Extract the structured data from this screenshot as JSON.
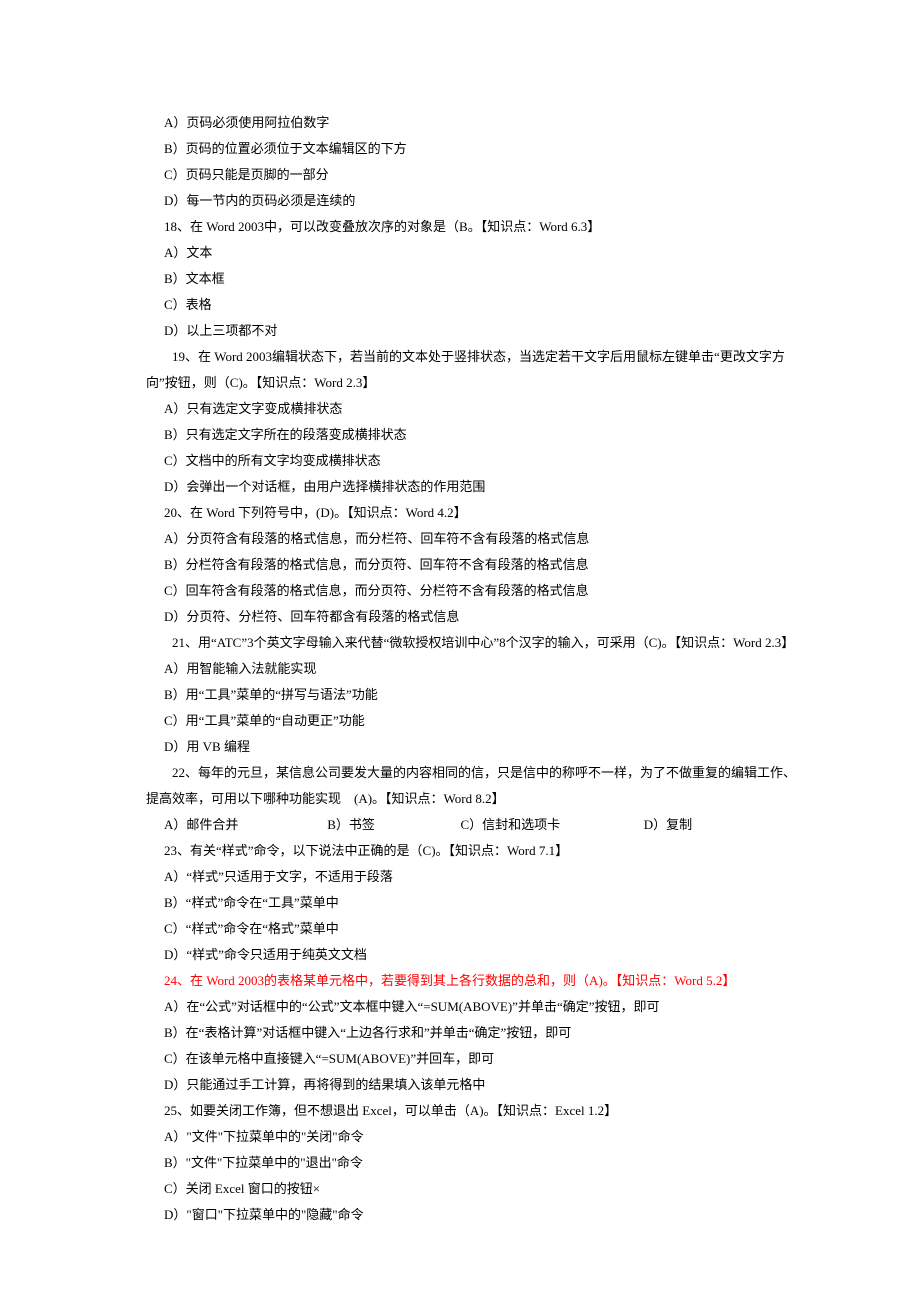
{
  "lines": [
    {
      "cls": "indent1",
      "text": "A）页码必须使用阿拉伯数字"
    },
    {
      "cls": "indent1",
      "text": "B）页码的位置必须位于文本编辑区的下方"
    },
    {
      "cls": "indent1",
      "text": "C）页码只能是页脚的一部分"
    },
    {
      "cls": "indent1",
      "text": "D）每一节内的页码必须是连续的"
    },
    {
      "cls": "indent1",
      "text": "18、在 Word 2003中，可以改变叠放次序的对象是（B。【知识点：Word 6.3】"
    },
    {
      "cls": "indent1",
      "text": "A）文本"
    },
    {
      "cls": "indent1",
      "text": "B）文本框"
    },
    {
      "cls": "indent1",
      "text": "C）表格"
    },
    {
      "cls": "indent1",
      "text": "D）以上三项都不对"
    },
    {
      "cls": "indent2",
      "text": "　　19、在 Word 2003编辑状态下，若当前的文本处于竖排状态，当选定若干文字后用鼠标左键单击“更改文字方向”按钮，则（C)。【知识点：Word 2.3】"
    },
    {
      "cls": "indent1",
      "text": "A）只有选定文字变成横排状态"
    },
    {
      "cls": "indent1",
      "text": "B）只有选定文字所在的段落变成横排状态"
    },
    {
      "cls": "indent1",
      "text": "C）文档中的所有文字均变成横排状态"
    },
    {
      "cls": "indent1",
      "text": "D）会弹出一个对话框，由用户选择横排状态的作用范围"
    },
    {
      "cls": "indent1",
      "text": "20、在 Word 下列符号中，(D)。【知识点：Word 4.2】"
    },
    {
      "cls": "indent1",
      "text": "A）分页符含有段落的格式信息，而分栏符、回车符不含有段落的格式信息"
    },
    {
      "cls": "indent1",
      "text": "B）分栏符含有段落的格式信息，而分页符、回车符不含有段落的格式信息"
    },
    {
      "cls": "indent1",
      "text": "C）回车符含有段落的格式信息，而分页符、分栏符不含有段落的格式信息"
    },
    {
      "cls": "indent1",
      "text": "D）分页符、分栏符、回车符都含有段落的格式信息"
    },
    {
      "cls": "indent2",
      "text": "　　21、用“ATC”3个英文字母输入来代替“微软授权培训中心”8个汉字的输入，可采用（C)。【知识点：Word 2.3】"
    },
    {
      "cls": "indent1",
      "text": "A）用智能输入法就能实现"
    },
    {
      "cls": "indent1",
      "text": "B）用“工具”菜单的“拼写与语法”功能"
    },
    {
      "cls": "indent1",
      "text": "C）用“工具”菜单的“自动更正”功能"
    },
    {
      "cls": "indent1",
      "text": "D）用 VB 编程"
    },
    {
      "cls": "indent2",
      "text": "　　22、每年的元旦，某信息公司要发大量的内容相同的信，只是信中的称呼不一样，为了不做重复的编辑工作、提高效率，可用以下哪种功能实现　(A)。【知识点：Word 8.2】"
    }
  ],
  "optRow": {
    "a": "A）邮件合并",
    "b": "B）书签",
    "c": "C）信封和选项卡",
    "d": "D）复制"
  },
  "lines2": [
    {
      "cls": "indent1",
      "text": "23、有关“样式”命令，以下说法中正确的是（C)。【知识点：Word 7.1】"
    },
    {
      "cls": "indent1",
      "text": "A）“样式”只适用于文字，不适用于段落"
    },
    {
      "cls": "indent1",
      "text": "B）“样式”命令在“工具”菜单中"
    },
    {
      "cls": "indent1",
      "text": "C）“样式”命令在“格式”菜单中"
    },
    {
      "cls": "indent1",
      "text": "D）“样式”命令只适用于纯英文文档"
    },
    {
      "cls": "indent1 red",
      "text": "24、在 Word 2003的表格某单元格中，若要得到其上各行数据的总和，则（A)。【知识点：Word 5.2】"
    },
    {
      "cls": "indent1",
      "text": "A）在“公式”对话框中的“公式”文本框中键入“=SUM(ABOVE)”并单击“确定”按钮，即可"
    },
    {
      "cls": "indent1",
      "text": "B）在“表格计算”对话框中键入“上边各行求和”并单击“确定”按钮，即可"
    },
    {
      "cls": "indent1",
      "text": "C）在该单元格中直接键入“=SUM(ABOVE)”并回车，即可"
    },
    {
      "cls": "indent1",
      "text": "D）只能通过手工计算，再将得到的结果填入该单元格中"
    },
    {
      "cls": "indent1",
      "text": "25、如要关闭工作簿，但不想退出 Excel，可以单击（A)。【知识点：Excel 1.2】"
    },
    {
      "cls": "indent1",
      "text": "A）\"文件\"下拉菜单中的\"关闭\"命令"
    },
    {
      "cls": "indent1",
      "text": "B）\"文件\"下拉菜单中的\"退出\"命令"
    },
    {
      "cls": "indent1",
      "text": "C）关闭 Excel 窗口的按钮×"
    },
    {
      "cls": "indent1",
      "text": "D）\"窗口\"下拉菜单中的\"隐藏\"命令"
    }
  ]
}
